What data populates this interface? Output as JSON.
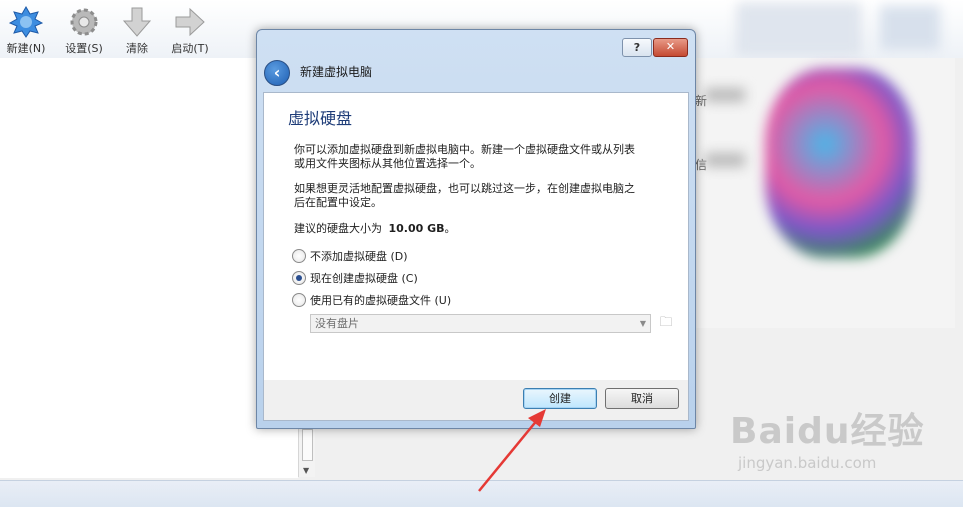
{
  "toolbar": {
    "items": [
      {
        "label": "新建(N)",
        "icon": "new-vm-icon"
      },
      {
        "label": "设置(S)",
        "icon": "settings-gear-icon"
      },
      {
        "label": "清除",
        "icon": "discard-arrow-icon"
      },
      {
        "label": "启动(T)",
        "icon": "start-arrow-icon"
      }
    ]
  },
  "right_panel_partial": {
    "char1": "新",
    "char2": "信"
  },
  "dialog": {
    "window_title": "新建虚拟电脑",
    "help_glyph": "?",
    "close_glyph": "✕",
    "page_title": "虚拟硬盘",
    "paragraph1_line1": "你可以添加虚拟硬盘到新虚拟电脑中。新建一个虚拟硬盘文件或从列表",
    "paragraph1_line2": "或用文件夹图标从其他位置选择一个。",
    "paragraph2_line1": "如果想更灵活地配置虚拟硬盘，也可以跳过这一步，在创建虚拟电脑之",
    "paragraph2_line2": "后在配置中设定。",
    "recommended_prefix": "建议的硬盘大小为",
    "recommended_size": "10.00 GB",
    "recommended_suffix": "。",
    "options": [
      {
        "label": "不添加虚拟硬盘 (D)",
        "selected": false
      },
      {
        "label": "现在创建虚拟硬盘 (C)",
        "selected": true
      },
      {
        "label": "使用已有的虚拟硬盘文件 (U)",
        "selected": false
      }
    ],
    "disk_combo_value": "没有盘片",
    "create_button": "创建",
    "cancel_button": "取消"
  },
  "watermark": {
    "brand": "Baidu经验",
    "url": "jingyan.baidu.com"
  },
  "colors": {
    "accent_red": "#e53935",
    "dialog_frame": "#b9d1ec",
    "title_blue": "#1e3c78"
  }
}
